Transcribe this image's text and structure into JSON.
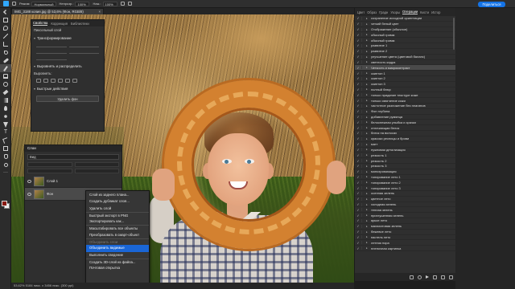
{
  "optionsbar": {
    "mode_label": "Режим:",
    "mode_value": "Нормальный",
    "opacity_label": "Непрозр.:",
    "opacity_value": "100%",
    "flow_label": "Наж.:",
    "flow_value": "100%",
    "share_label": "Поделиться"
  },
  "document": {
    "tab_title": "IMG_3188 копия.jpg @ 53,6% (Фон, RGB/8)",
    "close_glyph": "×"
  },
  "properties_panel": {
    "tabs": [
      "Свойства",
      "Коррекция",
      "Библиотеки"
    ],
    "active_tab": 0,
    "layer_type": "Пиксельный слой",
    "section_transform": "Трансформирование",
    "section_align": "Выровнять и распределить",
    "align_label": "Выровнять:",
    "section_quick": "Быстрые действия",
    "remove_bg_button": "Удалить фон"
  },
  "layers_panel": {
    "title": "Слои",
    "search_value": "Вид",
    "rows": [
      {
        "name": "Слой 1",
        "selected": false
      },
      {
        "name": "Фон",
        "selected": true
      }
    ]
  },
  "context_menu": {
    "items": [
      {
        "label": "Слой из заднего плана...",
        "disabled": false,
        "highlight": false
      },
      {
        "label": "Создать дубликат слоя...",
        "disabled": false,
        "highlight": false
      },
      {
        "label": "Удалить слой",
        "disabled": false,
        "highlight": false
      },
      {
        "label": "Быстрый экспорт в PNG",
        "disabled": false,
        "highlight": false
      },
      {
        "label": "Экспортировать как...",
        "disabled": false,
        "highlight": false
      },
      {
        "label": "Масштабировать все объекты",
        "disabled": false,
        "highlight": false
      },
      {
        "label": "Преобразовать в смарт-объект",
        "disabled": false,
        "highlight": false
      },
      {
        "label": "Объединить слои",
        "disabled": true,
        "highlight": false
      },
      {
        "label": "Объединить видимые",
        "disabled": false,
        "highlight": true
      },
      {
        "label": "Выполнить сведение",
        "disabled": false,
        "highlight": false
      },
      {
        "label": "Создать 3D-слой из файла...",
        "disabled": false,
        "highlight": false
      },
      {
        "label": "Почтовая открытка",
        "disabled": false,
        "highlight": false
      }
    ]
  },
  "actions_panel": {
    "tabs": [
      "Цвет",
      "Образ",
      "Градн",
      "Узоры",
      "Операции",
      "Кисти",
      "Истор"
    ],
    "active_tab": 4,
    "rows": [
      {
        "label": "сохранение исходной ориентации",
        "selected": false
      },
      {
        "label": "четкий белый цвет",
        "selected": false
      },
      {
        "label": "Отображение (обычное)",
        "selected": false
      },
      {
        "label": "обычный гримм",
        "selected": false
      },
      {
        "label": "обычный гримм",
        "selected": false
      },
      {
        "label": "развитие 1",
        "selected": false
      },
      {
        "label": "развитие 2",
        "selected": false
      },
      {
        "label": "улучшение цвета (цветовой баланс)",
        "selected": false
      },
      {
        "label": "светлость кадра",
        "selected": false
      },
      {
        "label": "Четкость и микроконтраст",
        "selected": true
      },
      {
        "label": "скинтон 1",
        "selected": false
      },
      {
        "label": "скинтон 2",
        "selected": false
      },
      {
        "label": "скинтон 3",
        "selected": false
      },
      {
        "label": "полный блюр",
        "selected": false
      },
      {
        "label": "только придание текстуре коже",
        "selected": false
      },
      {
        "label": "только смягчение кожи",
        "selected": false
      },
      {
        "label": "частотное разложение без плагинов",
        "selected": false
      },
      {
        "label": "Фон глубина",
        "selected": false
      },
      {
        "label": "добавление румянца",
        "selected": false
      },
      {
        "label": "белоснежная улыбка и зрачки",
        "selected": false
      },
      {
        "label": "отличающая белок",
        "selected": false
      },
      {
        "label": "блеск на волосах",
        "selected": false
      },
      {
        "label": "красоки ресницы и брови",
        "selected": false
      },
      {
        "label": "матт",
        "selected": false
      },
      {
        "label": "нужновая детализация",
        "selected": false
      },
      {
        "label": "резкость 1",
        "selected": false
      },
      {
        "label": "резкость 2",
        "selected": false
      },
      {
        "label": "резкость 3",
        "selected": false
      },
      {
        "label": "монохромизация",
        "selected": false
      },
      {
        "label": "тонирование лето 1",
        "selected": false
      },
      {
        "label": "тонирование лето 2",
        "selected": false
      },
      {
        "label": "тонирование лето 3",
        "selected": false
      },
      {
        "label": "осенняя зелень",
        "selected": false
      },
      {
        "label": "цветное лето",
        "selected": false
      },
      {
        "label": "холодная зелень",
        "selected": false
      },
      {
        "label": "теплая зелень",
        "selected": false
      },
      {
        "label": "приглушенная зелень",
        "selected": false
      },
      {
        "label": "яркое лето",
        "selected": false
      },
      {
        "label": "малахитовая зелень",
        "selected": false
      },
      {
        "label": "бежевое лето",
        "selected": false
      },
      {
        "label": "пастель лето",
        "selected": false
      },
      {
        "label": "летняя пора",
        "selected": false
      },
      {
        "label": "пленочная картинка",
        "selected": false
      }
    ]
  },
  "status": {
    "text": "53,62%   5184 пикс. x 3456 пикс. (300 ppi)"
  },
  "colors": {
    "foreground": "#8a1a10",
    "background": "#efefef",
    "accent": "#1a66d6"
  }
}
